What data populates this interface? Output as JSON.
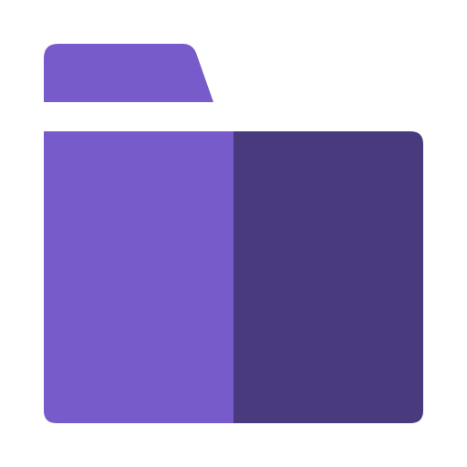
{
  "icon": {
    "name": "folder-icon",
    "colors": {
      "tab": "#775bca",
      "body_left": "#775bca",
      "body_right": "#483a7c",
      "background": "#ffffff"
    }
  }
}
